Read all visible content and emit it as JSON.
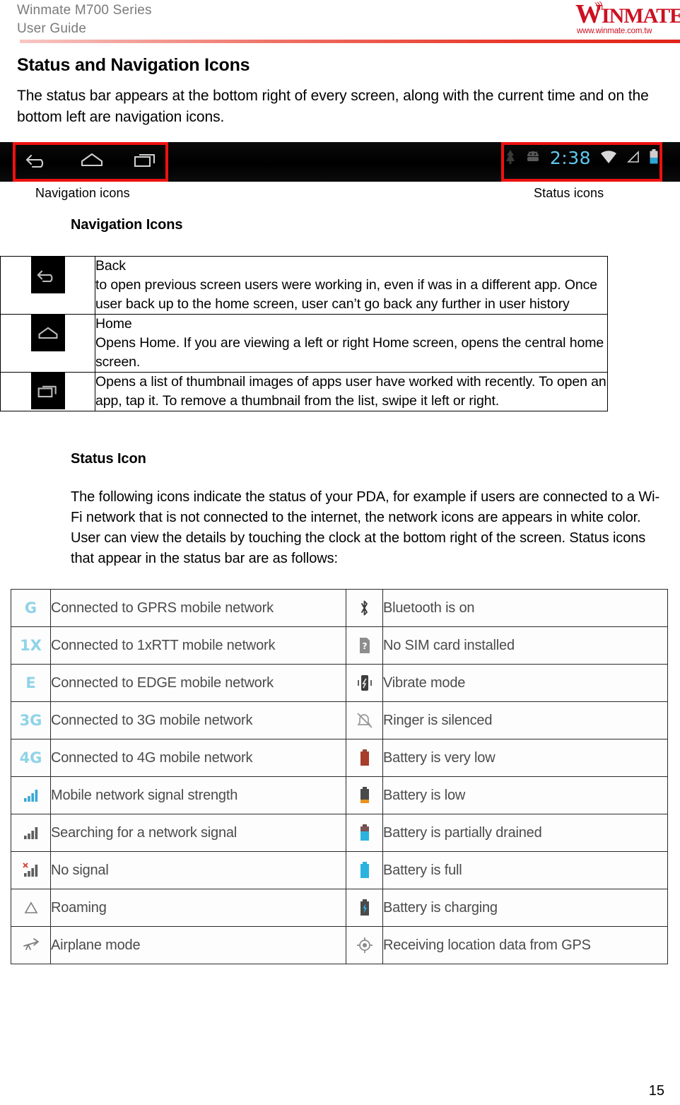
{
  "header": {
    "line1": "Winmate M700 Series",
    "line2": "User Guide",
    "logo_w": "W",
    "logo_rest": "INMATE",
    "logo_waves": ")))",
    "logo_url": "www.winmate.com.tw"
  },
  "section": {
    "title": "Status and Navigation Icons",
    "intro": "The status bar appears at the bottom right of every screen, along with the current time and on the bottom left are navigation icons."
  },
  "bar_figure": {
    "clock": "2:38",
    "caption_left": "Navigation icons",
    "caption_right": "Status icons",
    "nav_icons": [
      "back-icon",
      "home-icon",
      "recents-icon"
    ],
    "status_icons": [
      "download-icon",
      "android-robot-icon",
      "clock-text",
      "wifi-icon",
      "signal-icon",
      "battery-icon"
    ],
    "highlight_color": "#ee1111",
    "clock_color": "#5fc8ef"
  },
  "nav_section": {
    "title": "Navigation Icons",
    "rows": [
      {
        "icon": "back-icon",
        "name": "Back",
        "desc": "to open previous screen users were working in, even if was in a different app. Once user back up to the home screen, user can’t go back any further in user history"
      },
      {
        "icon": "home-icon",
        "name": "Home",
        "desc": "Opens Home. If you are viewing a left or right Home screen, opens the central home screen."
      },
      {
        "icon": "recents-icon",
        "name": "",
        "desc": "Opens a list of thumbnail images of apps user have worked with recently. To open an app, tap it. To remove a thumbnail from the list, swipe it left or right."
      }
    ]
  },
  "status_section": {
    "title": "Status Icon",
    "intro": "The following icons indicate the status of your PDA, for example if users are connected to a Wi-Fi network that is not connected to the internet, the network icons are appears in white color. User can view the details by touching the clock at the bottom right of the screen. Status icons that appear in the status bar are as follows:",
    "left_column": [
      {
        "icon": "gprs-text-icon",
        "glyph": "G",
        "label": "Connected to GPRS mobile network"
      },
      {
        "icon": "onexrtt-text-icon",
        "glyph": "1X",
        "label": "Connected to 1xRTT mobile network"
      },
      {
        "icon": "edge-text-icon",
        "glyph": "E",
        "label": "Connected to EDGE mobile network"
      },
      {
        "icon": "threeg-text-icon",
        "glyph": "3G",
        "label": "Connected to 3G mobile network"
      },
      {
        "icon": "fourg-text-icon",
        "glyph": "4G",
        "label": "Connected to 4G mobile network"
      },
      {
        "icon": "signal-strength-icon",
        "glyph": "",
        "label": "Mobile network signal strength"
      },
      {
        "icon": "signal-searching-icon",
        "glyph": "",
        "label": "Searching for a network signal"
      },
      {
        "icon": "no-signal-icon",
        "glyph": "",
        "label": "No signal"
      },
      {
        "icon": "roaming-icon",
        "glyph": "",
        "label": "Roaming"
      },
      {
        "icon": "airplane-mode-icon",
        "glyph": "",
        "label": "Airplane mode"
      }
    ],
    "right_column": [
      {
        "icon": "bluetooth-icon",
        "label": "Bluetooth is on"
      },
      {
        "icon": "no-sim-card-icon",
        "label": "No SIM card installed"
      },
      {
        "icon": "vibrate-mode-icon",
        "label": "Vibrate mode"
      },
      {
        "icon": "ringer-silenced-icon",
        "label": "Ringer is silenced"
      },
      {
        "icon": "battery-very-low-icon",
        "label": "Battery is very low"
      },
      {
        "icon": "battery-low-icon",
        "label": "Battery is low"
      },
      {
        "icon": "battery-partial-icon",
        "label": "Battery is partially drained"
      },
      {
        "icon": "battery-full-icon",
        "label": "Battery is full"
      },
      {
        "icon": "battery-charging-icon",
        "label": "Battery is charging"
      },
      {
        "icon": "gps-location-icon",
        "label": "Receiving location data from GPS"
      }
    ],
    "icon_text_color": "#8fd3e8"
  },
  "footer": {
    "page_number": "15"
  }
}
